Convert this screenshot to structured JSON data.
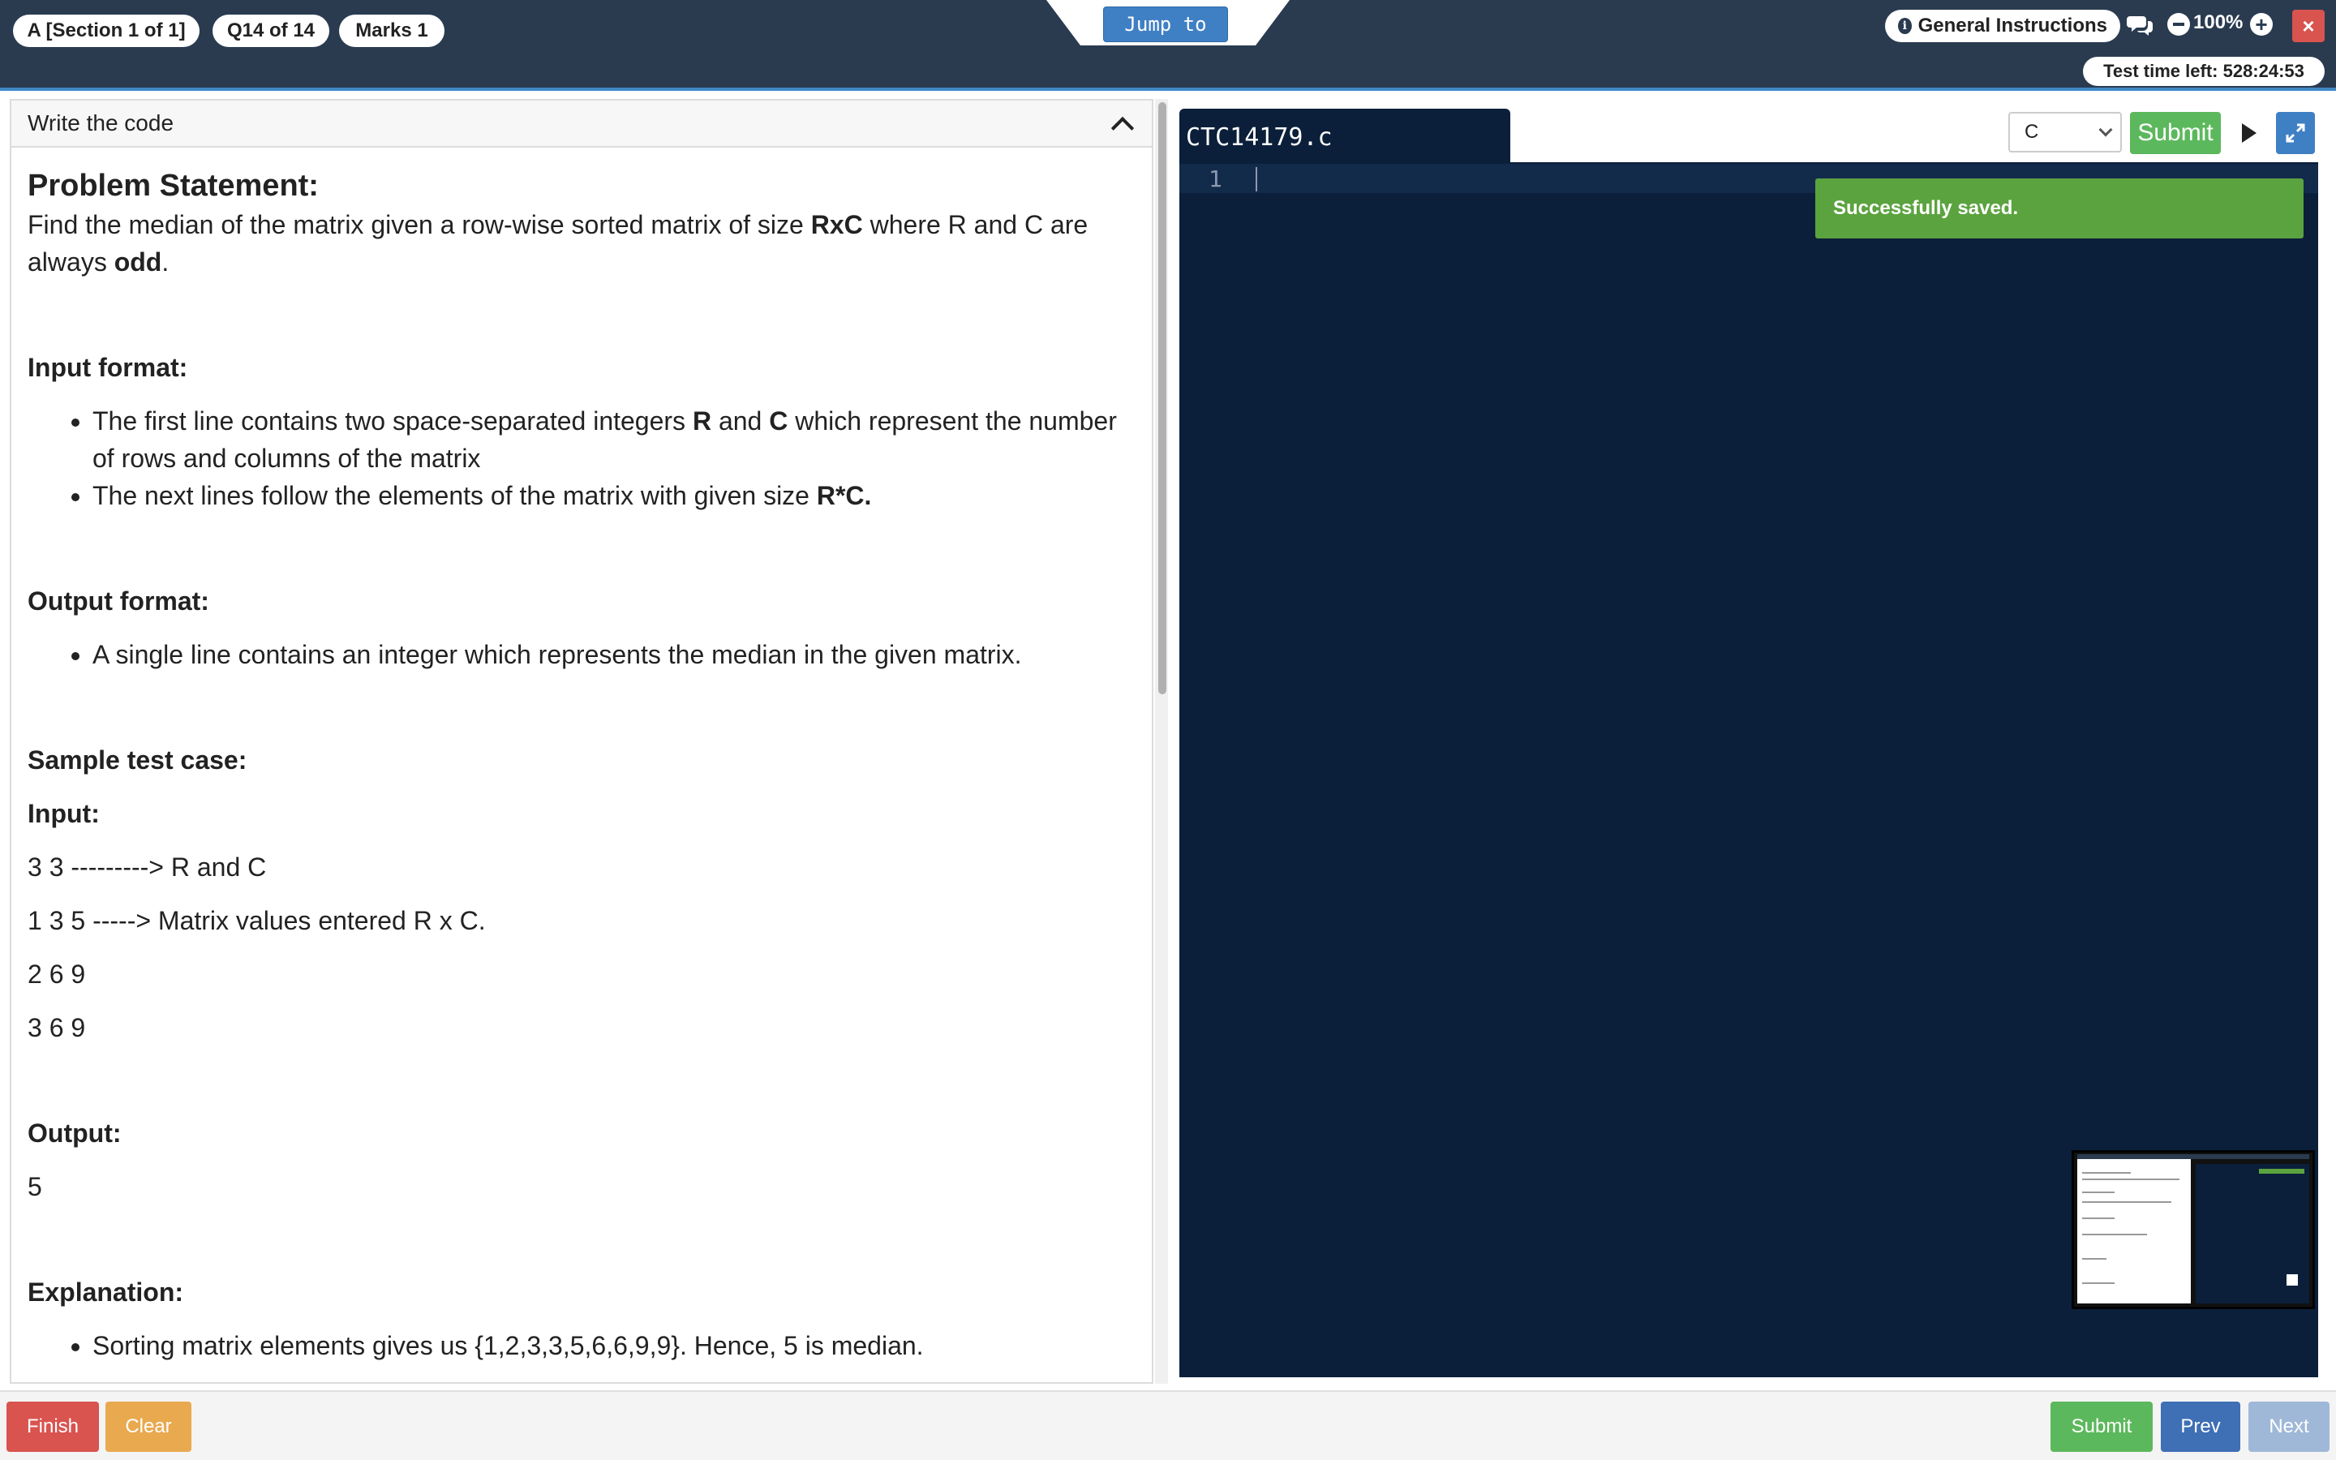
{
  "header": {
    "section_label": "A [Section 1 of 1]",
    "question_label": "Q14 of 14",
    "marks_label": "Marks 1",
    "jump_label": "Jump to",
    "general_instructions_label": "General Instructions",
    "zoom_level": "100%",
    "close_label": "×",
    "timer_label": "Test time left: 528:24:53"
  },
  "problem": {
    "panel_title": "Write the code",
    "title": "Problem Statement:",
    "statement_pre": "Find the median of the matrix given a row-wise sorted matrix of size ",
    "statement_bold1": "RxC",
    "statement_mid": " where R and C are always ",
    "statement_bold2": "odd",
    "statement_post": ".",
    "input_format_heading": "Input format:",
    "input_items": [
      {
        "pre": "The first line contains two space-separated integers ",
        "b1": "R",
        "mid": " and ",
        "b2": "C",
        "post": " which represent the number of rows and columns of the matrix"
      },
      {
        "pre": "The next lines follow the elements of the matrix with given size ",
        "b1": "R*C."
      }
    ],
    "output_format_heading": "Output format:",
    "output_items": [
      "A single line contains an integer which represents the median in the given matrix."
    ],
    "sample_heading": "Sample test case:",
    "input_heading": "Input:",
    "input_lines": [
      "3 3 ---------> R and C",
      "1 3 5 -----> Matrix values entered R x C.",
      "2 6 9",
      "3 6 9"
    ],
    "output_heading": "Output:",
    "output_value": "5",
    "explanation_heading": "Explanation:",
    "explanation_items": [
      "Sorting matrix elements gives us {1,2,3,3,5,6,6,9,9}. Hence, 5 is median."
    ]
  },
  "editor": {
    "file_name": "CTC14179.c",
    "language": "C",
    "submit_label": "Submit",
    "line_number": "1",
    "toast_message": "Successfully saved."
  },
  "footer": {
    "finish_label": "Finish",
    "clear_label": "Clear",
    "submit_label": "Submit",
    "prev_label": "Prev",
    "next_label": "Next"
  },
  "colors": {
    "topbar": "#2a3b50",
    "editor_bg": "#0b1f3a",
    "finish": "#d9534f",
    "clear": "#e9a94f",
    "submit": "#5cb85c",
    "prev": "#3f6fb5",
    "next_disabled": "#9fb8d8",
    "toast": "#5ba33f"
  }
}
